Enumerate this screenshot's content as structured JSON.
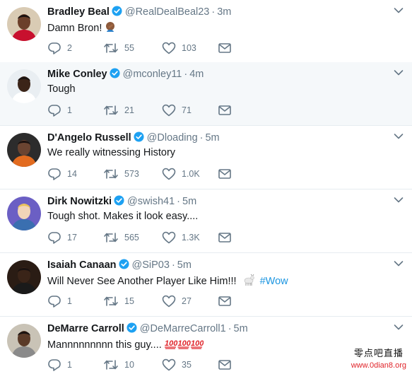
{
  "tweets": [
    {
      "name": "Bradley Beal",
      "handle": "@RealDealBeal23",
      "time": "3m",
      "text": "Damn Bron!",
      "emoji": "facepalm",
      "hashtag": "",
      "replies": "2",
      "retweets": "55",
      "likes": "103",
      "highlighted": false,
      "avatar": {
        "skin": "#6b3f2a",
        "shirt": "#c8102e",
        "bg": "#d9cbb4"
      }
    },
    {
      "name": "Mike Conley",
      "handle": "@mconley11",
      "time": "4m",
      "text": "Tough",
      "emoji": "",
      "hashtag": "",
      "replies": "1",
      "retweets": "21",
      "likes": "71",
      "highlighted": true,
      "avatar": {
        "skin": "#3b2418",
        "shirt": "#ffffff",
        "bg": "#e9eef2"
      }
    },
    {
      "name": "D'Angelo Russell",
      "handle": "@Dloading",
      "time": "5m",
      "text": "We really witnessing History",
      "emoji": "",
      "hashtag": "",
      "replies": "14",
      "retweets": "573",
      "likes": "1.0K",
      "highlighted": false,
      "avatar": {
        "skin": "#6a4431",
        "shirt": "#e26b1f",
        "bg": "#2c2c2c"
      }
    },
    {
      "name": "Dirk Nowitzki",
      "handle": "@swish41",
      "time": "5m",
      "text": "Tough shot. Makes it look easy....",
      "emoji": "",
      "hashtag": "",
      "replies": "17",
      "retweets": "565",
      "likes": "1.3K",
      "highlighted": false,
      "avatar": {
        "skin": "#f2d5b8",
        "shirt": "#3a6fb0",
        "bg": "#6b5fc4"
      }
    },
    {
      "name": "Isaiah Canaan",
      "handle": "@SiP03",
      "time": "5m",
      "text": "Will Never See Another Player Like Him!!! ",
      "emoji": "goat",
      "hashtag": "#Wow",
      "replies": "1",
      "retweets": "15",
      "likes": "27",
      "highlighted": false,
      "avatar": {
        "skin": "#3a2418",
        "shirt": "#1a1a1a",
        "bg": "#2a1c14"
      }
    },
    {
      "name": "DeMarre Carroll",
      "handle": "@DeMarreCarroll1",
      "time": "5m",
      "text": "Mannnnnnnnn this guy....",
      "emoji": "hundred",
      "hashtag": "",
      "replies": "1",
      "retweets": "10",
      "likes": "35",
      "highlighted": false,
      "avatar": {
        "skin": "#5a3a28",
        "shirt": "#8a8a8a",
        "bg": "#c9c3b6"
      }
    }
  ],
  "colors": {
    "verified": "#1da1f2",
    "hashtag": "#1b95e0",
    "muted": "#657786"
  },
  "icons": {
    "reply": "reply-icon",
    "retweet": "retweet-icon",
    "like": "heart-icon",
    "dm": "envelope-icon",
    "caret": "chevron-down-icon"
  },
  "watermark": {
    "cn": "零点吧直播",
    "url": "www.0dian8.org"
  }
}
